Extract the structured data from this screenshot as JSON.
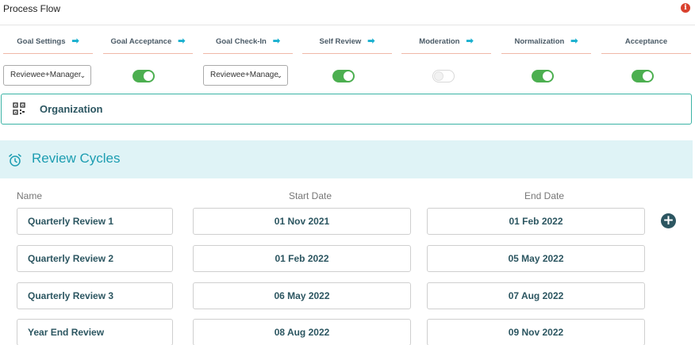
{
  "header": {
    "title": "Process Flow",
    "info_icon": "i"
  },
  "steps": [
    {
      "label": "Goal Settings",
      "arrow": "➡"
    },
    {
      "label": "Goal Acceptance",
      "arrow": "➡"
    },
    {
      "label": "Goal Check-In",
      "arrow": "➡"
    },
    {
      "label": "Self Review",
      "arrow": "➡"
    },
    {
      "label": "Moderation",
      "arrow": "➡"
    },
    {
      "label": "Normalization",
      "arrow": "➡"
    },
    {
      "label": "Acceptance"
    }
  ],
  "controls": {
    "goal_settings_select": "Reviewee+Manager",
    "goal_acceptance_toggle": true,
    "goal_checkin_select": "Reviewee+Manage",
    "self_review_toggle": true,
    "moderation_toggle": false,
    "normalization_toggle": true,
    "acceptance_toggle": true,
    "select_chevron": "⌄"
  },
  "organization": {
    "label": "Organization",
    "icon": "qr-code-icon"
  },
  "review_cycles": {
    "title": "Review Cycles",
    "icon": "alarm-clock-icon",
    "columns": {
      "name": "Name",
      "start": "Start Date",
      "end": "End Date"
    },
    "rows": [
      {
        "name": "Quarterly Review 1",
        "start": "01 Nov 2021",
        "end": "01 Feb 2022"
      },
      {
        "name": "Quarterly Review 2",
        "start": "01 Feb 2022",
        "end": "05 May 2022"
      },
      {
        "name": "Quarterly Review 3",
        "start": "06 May 2022",
        "end": "07 Aug 2022"
      },
      {
        "name": "Year End Review",
        "start": "08 Aug 2022",
        "end": "09 Nov 2022"
      }
    ],
    "add_button": "+"
  },
  "colors": {
    "accent": "#1ab0cf",
    "toggle_on": "#4caf50",
    "heading": "#2c5661",
    "band": "#dff3f6"
  }
}
